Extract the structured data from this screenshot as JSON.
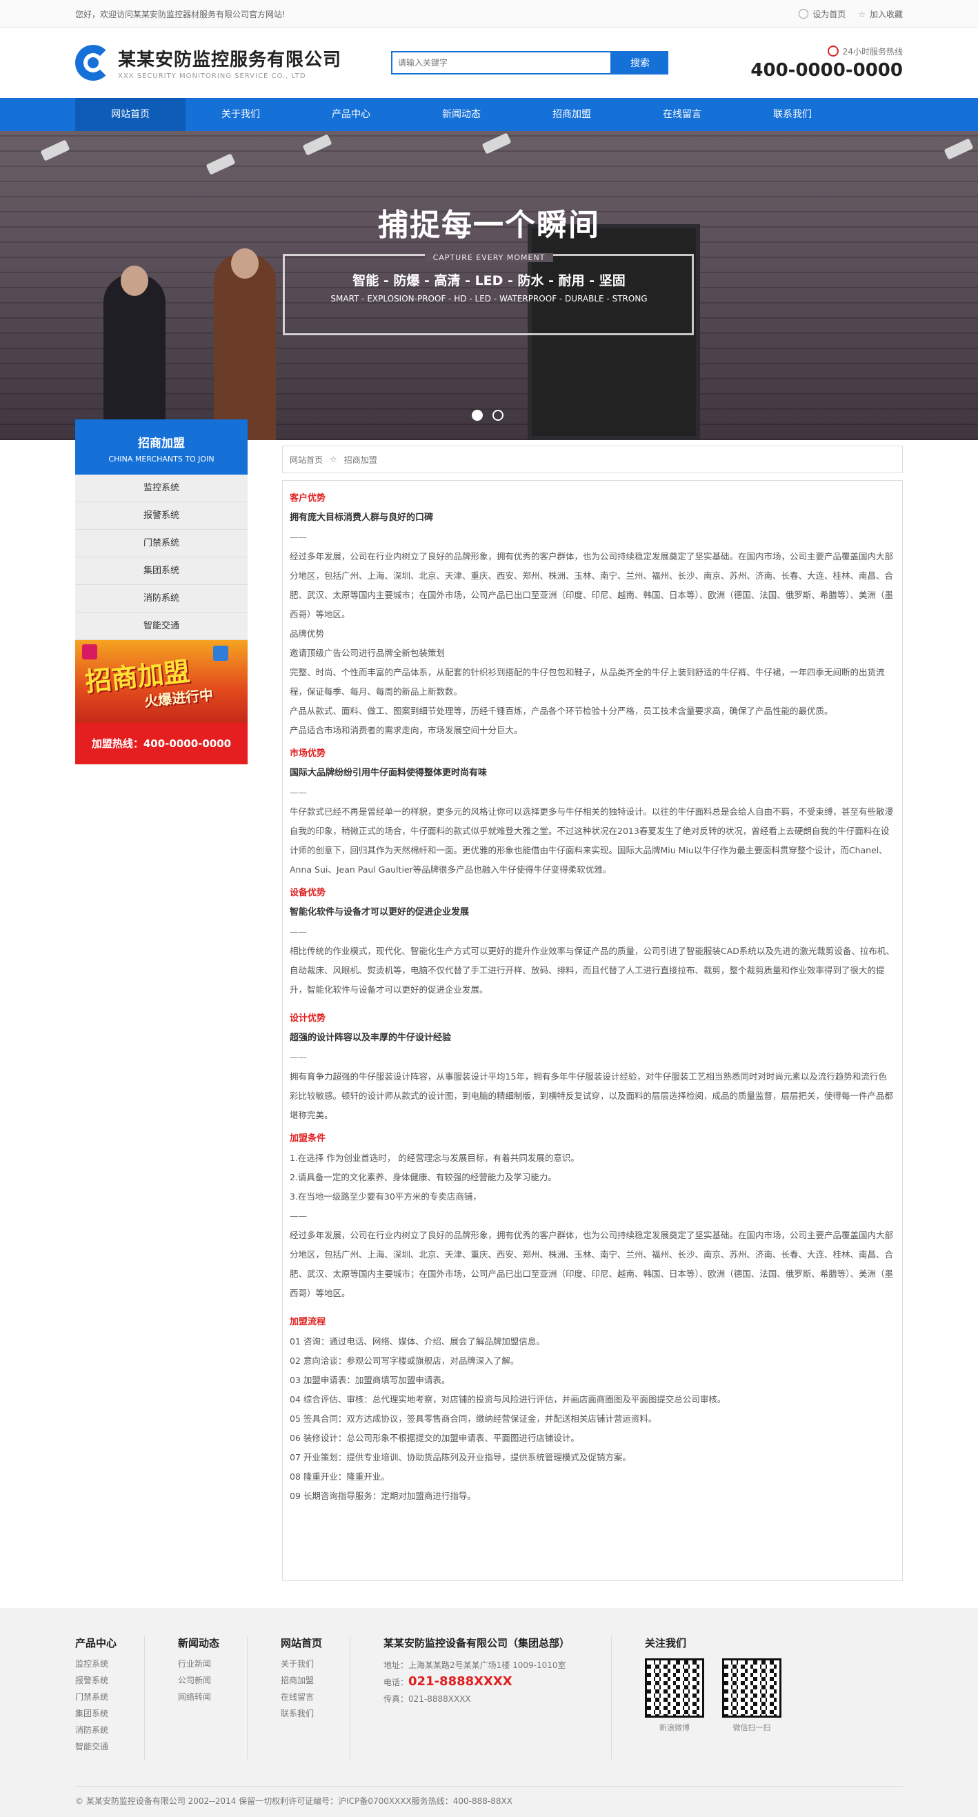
{
  "topbar": {
    "welcome": "您好，欢迎访问某某安防监控器材服务有限公司官方网站!",
    "set_home": "设为首页",
    "add_fav": "加入收藏"
  },
  "header": {
    "company_cn": "某某安防监控服务有限公司",
    "company_en": "XXX SECURITY MONITORING SERVICE CO., LTD",
    "search_placeholder": "请输入关键字",
    "search_button": "搜索",
    "hotline_label": "24小时服务热线",
    "hotline_number": "400-0000-0000"
  },
  "nav": [
    "网站首页",
    "关于我们",
    "产品中心",
    "新闻动态",
    "招商加盟",
    "在线留言",
    "联系我们"
  ],
  "banner": {
    "title": "捕捉每一个瞬间",
    "subtitle_en": "CAPTURE EVERY MOMENT",
    "tags": "智能 - 防爆 - 高清 - LED - 防水 - 耐用 - 坚固",
    "tags_en": "SMART - EXPLOSION-PROOF - HD - LED - WATERPROOF - DURABLE - STRONG"
  },
  "sidebar": {
    "title_cn": "招商加盟",
    "title_en": "CHINA MERCHANTS TO JOIN",
    "items": [
      "监控系统",
      "报警系统",
      "门禁系统",
      "集团系统",
      "消防系统",
      "智能交通"
    ],
    "promo_big": "招商加盟",
    "promo_small": "火爆进行中",
    "hotline": "加盟热线：400-0000-0000"
  },
  "breadcrumb": {
    "home": "网站首页",
    "sep": "☆",
    "current": "招商加盟"
  },
  "article": {
    "s1_title": "客户优势",
    "s1_sub": "拥有庞大目标消费人群与良好的口碑",
    "dash": "——",
    "s1_p1": "经过多年发展，公司在行业内树立了良好的品牌形象，拥有优秀的客户群体，也为公司持续稳定发展奠定了坚实基础。在国内市场，公司主要产品覆盖国内大部分地区，包括广州、上海、深圳、北京、天津、重庆、西安、郑州、株洲、玉林、南宁、兰州、福州、长沙、南京、苏州、济南、长春、大连、桂林、南昌、合肥、武汉、太原等国内主要城市；在国外市场，公司产品已出口至亚洲（印度、印尼、越南、韩国、日本等）、欧洲（德国、法国、俄罗斯、希腊等）、美洲（墨西哥）等地区。",
    "s1_p2": "品牌优势",
    "s1_p3": "邀请顶级广告公司进行品牌全新包装策划",
    "s1_p4": "完整、时尚、个性而丰富的产品体系，从配套的针织衫到搭配的牛仔包包和鞋子，从品类齐全的牛仔上装到舒适的牛仔裤、牛仔裙，一年四季无间断的出货流程，保证每季、每月、每周的新品上新数数。",
    "s1_p5": "产品从款式、面料、做工、图案到细节处理等，历经千锤百炼，产品各个环节检验十分严格，员工技术含量要求高，确保了产品性能的最优质。",
    "s1_p6": "产品适合市场和消费者的需求走向，市场发展空间十分巨大。",
    "s2_title": "市场优势",
    "s2_sub": "国际大品牌纷纷引用牛仔面料使得整体更时尚有味",
    "s2_p1": "牛仔款式已经不再是曾经单一的样貌，更多元的风格让你可以选择更多与牛仔相关的独特设计。以往的牛仔面料总是会给人自由不羁，不受束缚，甚至有些散漫自我的印象，稍微正式的场合，牛仔面料的款式似乎就难登大雅之堂。不过这种状况在2013春夏发生了绝对反转的状况，曾经看上去硬朗自我的牛仔面料在设计师的创意下，回归其作为天然棉纤和一面。更优雅的形象也能借由牛仔面料来实现。国际大品牌Miu Miu以牛仔作为最主要面料贯穿整个设计，而Chanel、Anna Sui、Jean Paul Gaultier等品牌很多产品也融入牛仔使得牛仔变得柔软优雅。",
    "s3_title": "设备优势",
    "s3_sub": "智能化软件与设备才可以更好的促进企业发展",
    "s3_p1": "相比传统的作业模式，现代化、智能化生产方式可以更好的提升作业效率与保证产品的质量，公司引进了智能服装CAD系统以及先进的激光裁剪设备、拉布机、自动裁床、风眼机、熨烫机等，电脑不仅代替了手工进行开样、放码、排料，而且代替了人工进行直接拉布、裁剪，整个裁剪质量和作业效率得到了很大的提升，智能化软件与设备才可以更好的促进企业发展。",
    "s4_title": "设计优势",
    "s4_sub": "超强的设计阵容以及丰厚的牛仔设计经验",
    "s4_p1": "拥有育争力超强的牛仔服装设计阵容，从事服装设计平均15年，拥有多年牛仔服装设计经验，对牛仔服装工艺相当熟悉同时对时尚元素以及流行趋势和流行色彩比较敏感。顿轩的设计师从款式的设计图，到电脑的精细制版，到横特反复试穿，以及面料的层层选择检阅，成品的质量监督，层层把关，使得每一件产品都堪称完美。",
    "s5_title": "加盟条件",
    "s5_c1": "1.在选择 作为创业首选时， 的经营理念与发展目标，有着共同发展的意识。",
    "s5_c2": "2.请具备一定的文化素养、身体健康、有较强的经营能力及学习能力。",
    "s5_c3": "3.在当地一级路至少要有30平方米的专卖店商铺，",
    "s5_p1": "经过多年发展，公司在行业内树立了良好的品牌形象，拥有优秀的客户群体，也为公司持续稳定发展奠定了坚实基础。在国内市场，公司主要产品覆盖国内大部分地区，包括广州、上海、深圳、北京、天津、重庆、西安、郑州、株洲、玉林、南宁、兰州、福州、长沙、南京、苏州、济南、长春、大连、桂林、南昌、合肥、武汉、太原等国内主要城市；在国外市场，公司产品已出口至亚洲（印度、印尼、越南、韩国、日本等）、欧洲（德国、法国、俄罗斯、希腊等）、美洲（墨西哥）等地区。",
    "s6_title": "加盟流程",
    "s6_steps": [
      "01 咨询：通过电话、网络、媒体、介绍、展会了解品牌加盟信息。",
      "02 意向洽谈：参观公司写字楼或旗舰店，对品牌深入了解。",
      "03 加盟申请表：加盟商填写加盟申请表。",
      "04 综合评估、审核：总代理实地考察，对店铺的投资与风险进行评估，并画店面商圈图及平面图提交总公司审核。",
      "05 签具合同：双方达成协议，签具零售商合同，缴纳经营保证金，并配送相关店铺计营运资料。",
      "06 装修设计：总公司形象不根据提交的加盟申请表、平面图进行店铺设计。",
      "07 开业策划：提供专业培训、协助货品陈列及开业指导，提供系统管理模式及促销方案。",
      "08 隆重开业：隆重开业。",
      "09 长期咨询指导服务：定期对加盟商进行指导。"
    ]
  },
  "footer": {
    "col1_title": "产品中心",
    "col1_items": [
      "监控系统",
      "报警系统",
      "门禁系统",
      "集团系统",
      "消防系统",
      "智能交通"
    ],
    "col2_title": "新闻动态",
    "col2_items": [
      "行业新闻",
      "公司新闻",
      "网络转闻"
    ],
    "col3_title": "网站首页",
    "col3_items": [
      "关于我们",
      "招商加盟",
      "在线留言",
      "联系我们"
    ],
    "company_title": "某某安防监控设备有限公司（集团总部）",
    "address": "地址：上海某某路2号某某广场1楼 1009-1010室",
    "phone_label": "电话：",
    "phone": "021-8888XXXX",
    "fax": "传真：021-8888XXXX",
    "follow_title": "关注我们",
    "qr1_caption": "新浪微博",
    "qr2_caption": "微信扫一扫",
    "copyright": "© 某某安防监控设备有限公司 2002--2014 保留一切权利许可证编号：沪ICP备0700XXXX服务热线：400-888-88XX"
  }
}
